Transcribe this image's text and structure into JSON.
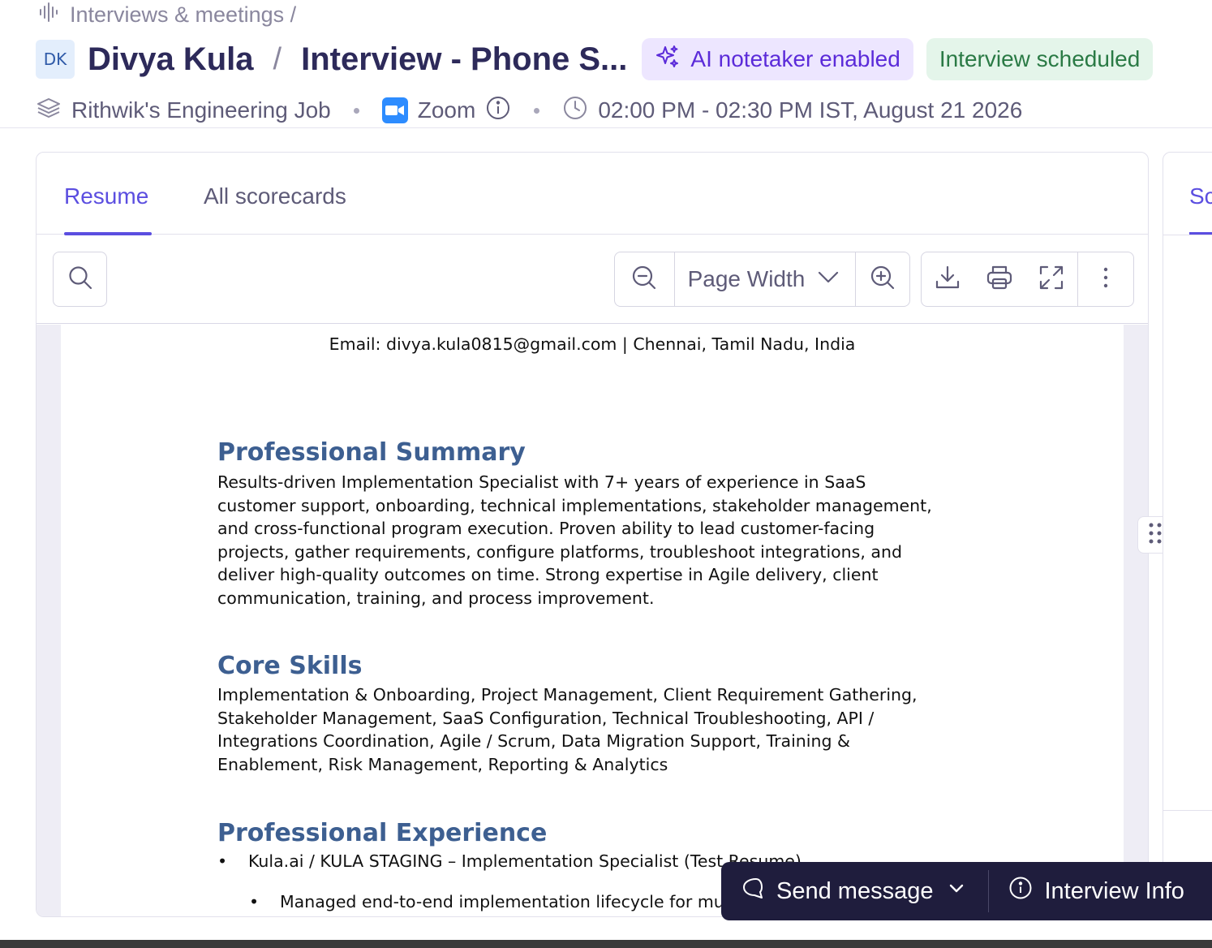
{
  "breadcrumb": {
    "label": "Interviews & meetings /"
  },
  "header": {
    "avatar_initials": "DK",
    "candidate_name": "Divya Kula",
    "separator": "/",
    "interview_title": "Interview - Phone S...",
    "ai_badge": "AI notetaker enabled",
    "status_badge": "Interview scheduled"
  },
  "meta": {
    "job": "Rithwik's Engineering Job",
    "platform": "Zoom",
    "time": "02:00 PM - 02:30 PM IST, August 21 2026"
  },
  "tabs": [
    {
      "label": "Resume",
      "active": true
    },
    {
      "label": "All scorecards",
      "active": false
    }
  ],
  "toolbar": {
    "zoom_select": "Page Width"
  },
  "resume": {
    "email_line": "Email: divya.kula0815@gmail.com | Chennai, Tamil Nadu, India",
    "summary_title": "Professional Summary",
    "summary_lines": [
      "Results-driven Implementation Specialist with 7+ years of experience in SaaS",
      "customer support, onboarding, technical implementations, stakeholder management,",
      "and cross-functional program execution. Proven ability to lead customer-facing",
      "projects, gather requirements, configure platforms, troubleshoot integrations, and",
      "deliver high-quality outcomes on time. Strong expertise in Agile delivery, client",
      "communication, training, and process improvement."
    ],
    "skills_title": "Core Skills",
    "skills_lines": [
      "Implementation & Onboarding, Project Management, Client Requirement Gathering,",
      "Stakeholder Management, SaaS Configuration, Technical Troubleshooting, API /",
      "Integrations Coordination, Agile / Scrum, Data Migration Support, Training &",
      "Enablement, Risk Management, Reporting & Analytics"
    ],
    "experience_title": "Professional Experience",
    "exp_item_1": "Kula.ai / KULA STAGING – Implementation Specialist (Test Resume)",
    "exp_item_2": "Managed end-to-end implementation lifecycle for multiple SaaS clients"
  },
  "side_panel": {
    "tab_label": "Sc"
  },
  "actions": {
    "send_message": "Send message",
    "interview_info": "Interview Info"
  },
  "colors": {
    "accent": "#5b4ee0",
    "ai_badge_bg": "#ede6ff",
    "status_badge_bg": "#e4f5ea",
    "heading_blue": "#3d5f91",
    "action_bar_bg": "#1f1d3d"
  }
}
